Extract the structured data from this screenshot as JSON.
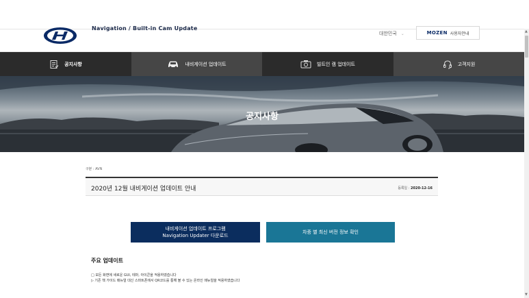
{
  "header": {
    "brand_sub": "Navigation / Built-in Cam Update",
    "language": "대한민국",
    "mozen_logo": "MOZEN",
    "mozen_guide": "사용자안내"
  },
  "nav": {
    "items": [
      {
        "label": "공지사항",
        "icon": "notice-list-icon"
      },
      {
        "label": "내비게이션 업데이트",
        "icon": "car-icon"
      },
      {
        "label": "빌트인 캠 업데이트",
        "icon": "camera-icon"
      },
      {
        "label": "고객지원",
        "icon": "headset-icon"
      }
    ]
  },
  "hero": {
    "title": "공지사항"
  },
  "post": {
    "category": "구분 : AVN",
    "title": "2020년 12월 내비게이션 업데이트 안내",
    "date_label": "등록일 : ",
    "date": "2020-12-16"
  },
  "buttons": {
    "navigation_line1": "내비게이션 업데이트 프로그램",
    "navigation_line2": "Navigation Updater 다운로드",
    "version_check": "차종 별 최신 버전 정보 확인"
  },
  "content": {
    "heading": "주요 업데이트",
    "bullet1": "□ 모든 화면에 새로운 GUI, 테마, 아이콘을 적용하였습니다",
    "bullet2": "▷ 기존 책 가이드 매뉴얼 대신 스마트폰에서 QR코드를 통해 볼 수 있는 온라인 매뉴얼을 적용하였습니다"
  },
  "colors": {
    "nav_dark": "#2b2b2b",
    "nav_mid": "#464646",
    "button_navy": "#0b2d5e",
    "button_teal": "#1a7696"
  }
}
